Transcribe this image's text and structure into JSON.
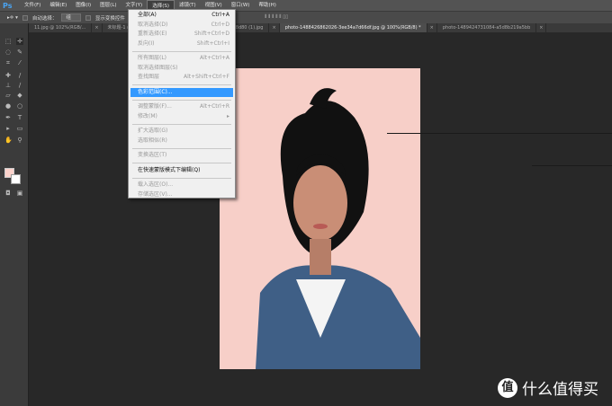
{
  "app": {
    "logo": "Ps"
  },
  "menubar": [
    "文件(F)",
    "编辑(E)",
    "图像(I)",
    "图层(L)",
    "文字(Y)",
    "选择(S)",
    "滤镜(T)",
    "视图(V)",
    "窗口(W)",
    "帮助(H)"
  ],
  "options": {
    "auto_select": "自动选择：",
    "auto_select_value": "组",
    "show_transform": "显示变换控件"
  },
  "tabs": [
    "11.jpg @ 102%(RGB/...",
    "未标题-1 @ 6...",
    "photo-1438761681033-6461ffad8d80 (1).jpg",
    "photo-1488426862026-3ee34a7d66df.jpg @ 100%(RGB/8) *",
    "photo-1489424731084-a5d8b219a5bb"
  ],
  "select_menu": [
    {
      "label": "全部(A)",
      "shortcut": "Ctrl+A",
      "enabled": true
    },
    {
      "label": "取消选择(D)",
      "shortcut": "Ctrl+D",
      "enabled": false
    },
    {
      "label": "重新选择(E)",
      "shortcut": "Shift+Ctrl+D",
      "enabled": false
    },
    {
      "label": "反向(I)",
      "shortcut": "Shift+Ctrl+I",
      "enabled": false
    },
    {
      "sep": true
    },
    {
      "label": "所有图层(L)",
      "shortcut": "Alt+Ctrl+A",
      "enabled": false
    },
    {
      "label": "取消选择图层(S)",
      "shortcut": "",
      "enabled": false
    },
    {
      "label": "查找图层",
      "shortcut": "Alt+Shift+Ctrl+F",
      "enabled": false
    },
    {
      "sep": true
    },
    {
      "label": "色彩范围(C)...",
      "shortcut": "",
      "enabled": true,
      "highlighted": true
    },
    {
      "sep": true
    },
    {
      "label": "调整蒙版(F)...",
      "shortcut": "Alt+Ctrl+R",
      "enabled": false
    },
    {
      "label": "修改(M)",
      "shortcut": "▸",
      "enabled": false
    },
    {
      "sep": true
    },
    {
      "label": "扩大选取(G)",
      "shortcut": "",
      "enabled": false
    },
    {
      "label": "选取相似(R)",
      "shortcut": "",
      "enabled": false
    },
    {
      "sep": true
    },
    {
      "label": "变换选区(T)",
      "shortcut": "",
      "enabled": false
    },
    {
      "sep": true
    },
    {
      "label": "在快速蒙版模式下编辑(Q)",
      "shortcut": "",
      "enabled": true
    },
    {
      "sep": true
    },
    {
      "label": "载入选区(O)...",
      "shortcut": "",
      "enabled": false
    },
    {
      "label": "存储选区(V)...",
      "shortcut": "",
      "enabled": false
    }
  ],
  "colors": {
    "foreground": "#fcd3cc",
    "background": "#ffffff",
    "highlight": "#3399ff"
  },
  "watermark": {
    "logo": "值",
    "text": "什么值得买"
  }
}
